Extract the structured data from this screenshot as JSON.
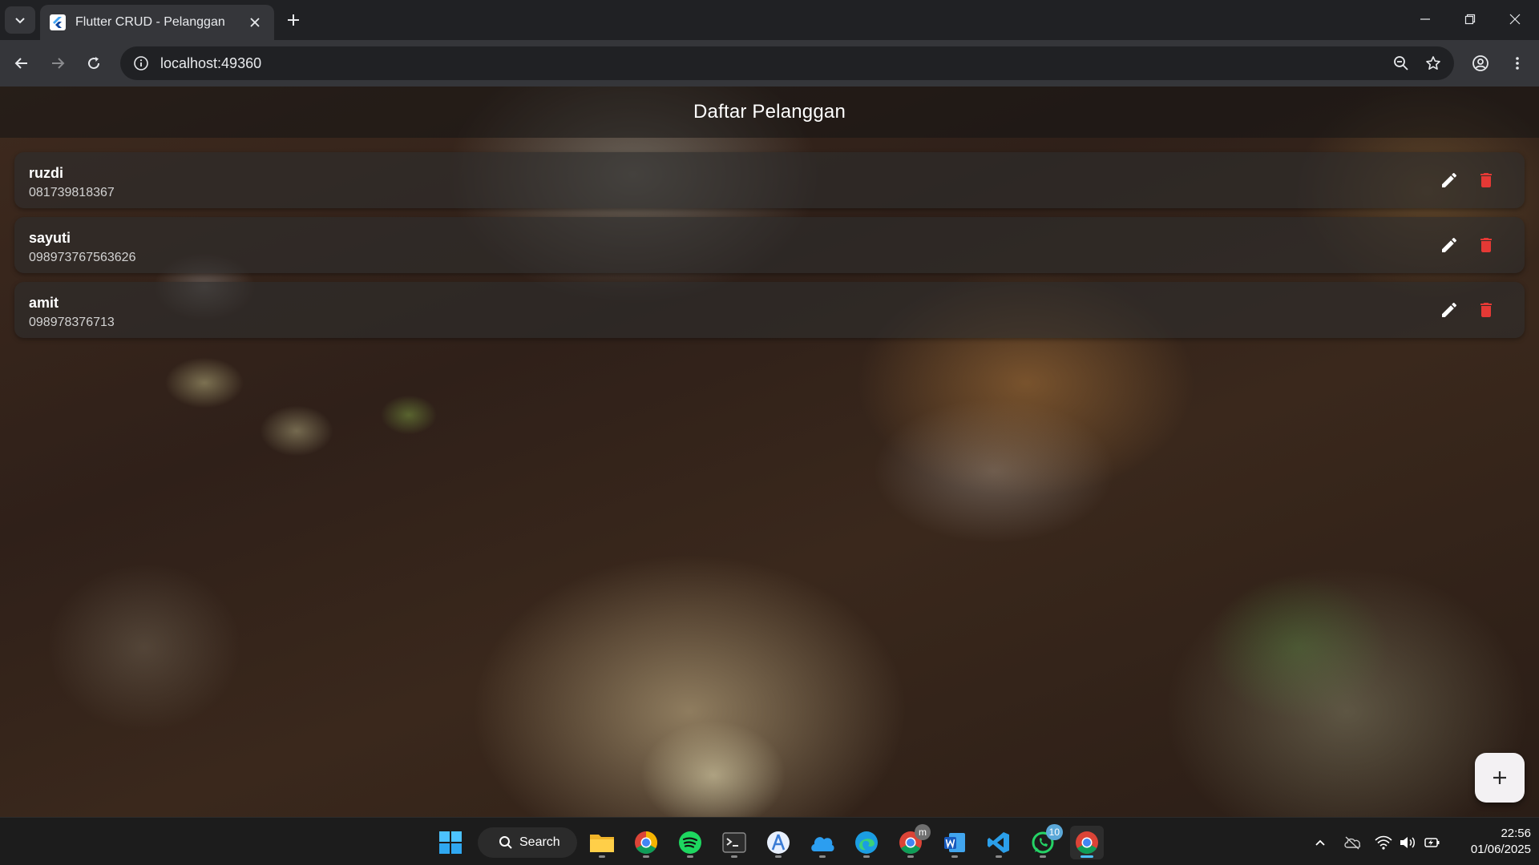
{
  "browser": {
    "tab_title": "Flutter CRUD - Pelanggan",
    "url": "localhost:49360"
  },
  "app": {
    "title": "Daftar Pelanggan",
    "customers": [
      {
        "name": "ruzdi",
        "phone": "081739818367"
      },
      {
        "name": "sayuti",
        "phone": "098973767563626"
      },
      {
        "name": "amit",
        "phone": "098978376713"
      }
    ],
    "fab_icon": "plus-icon",
    "colors": {
      "delete": "#e53935",
      "edit": "#ffffff",
      "fab_bg": "#f3f1f3"
    }
  },
  "taskbar": {
    "search_label": "Search",
    "apps": [
      "windows-start-icon",
      "file-explorer-icon",
      "chrome-icon",
      "spotify-icon",
      "terminal-icon",
      "android-studio-icon",
      "cloud-app-icon",
      "edge-icon",
      "chrome-profile-icon",
      "word-icon",
      "vscode-icon",
      "whatsapp-icon",
      "chrome-active-icon"
    ],
    "chrome_profile_badge": "m",
    "whatsapp_badge": "10",
    "time": "22:56",
    "date": "01/06/2025"
  }
}
